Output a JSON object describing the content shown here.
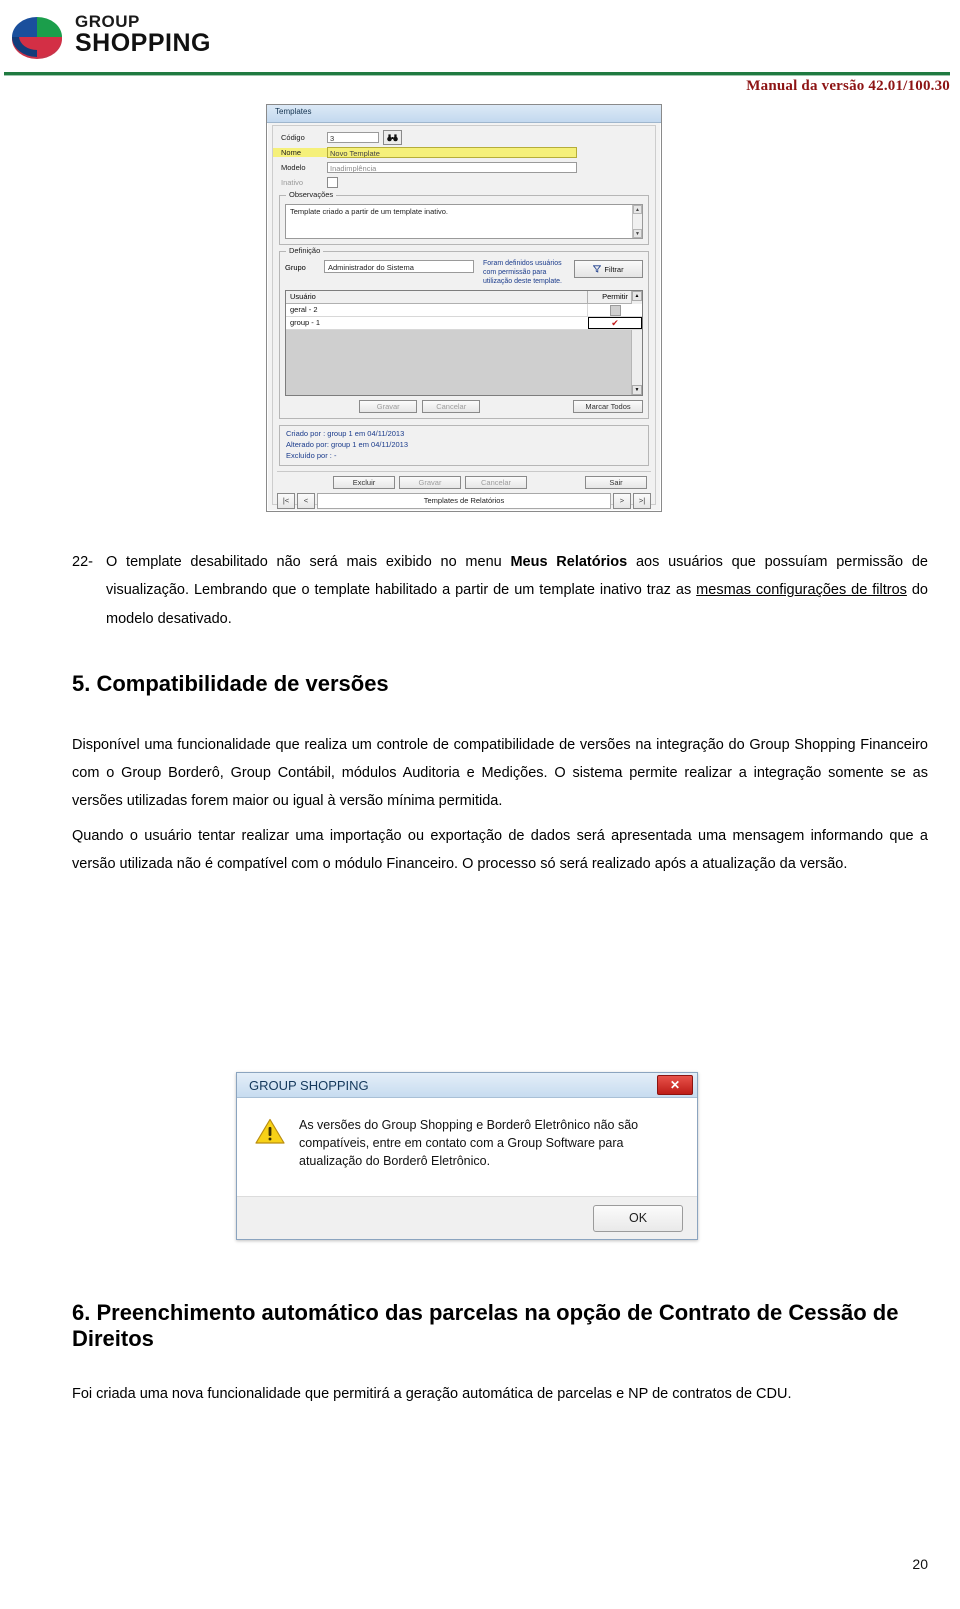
{
  "header": {
    "logo_line1": "GROUP",
    "logo_line2": "SHOPPING",
    "manual_version": "Manual da versão 42.01/100.30"
  },
  "templates_window": {
    "title": "Templates",
    "fields": {
      "codigo_label": "Código",
      "codigo_value": "3",
      "search_icon": "binoculars-icon",
      "nome_label": "Nome",
      "nome_value": "Novo Template",
      "modelo_label": "Modelo",
      "modelo_value": "Inadimplência",
      "inativo_label": "Inativo"
    },
    "observacoes": {
      "legend": "Observações",
      "text": "Template criado a partir de um template inativo."
    },
    "definicao": {
      "legend": "Definição",
      "grupo_label": "Grupo",
      "grupo_value": "Administrador do Sistema",
      "permission_note": "Foram definidos usuários com permissão para utilização deste template.",
      "filtrar_label": "Filtrar"
    },
    "user_table": {
      "columns": [
        "Usuário",
        "Permitir"
      ],
      "rows": [
        {
          "usuario": "geral - 2",
          "permitir": "unchecked"
        },
        {
          "usuario": "group - 1",
          "permitir": "checked"
        }
      ]
    },
    "inner_buttons": {
      "gravar": "Gravar",
      "cancelar": "Cancelar",
      "marcar_todos": "Marcar Todos"
    },
    "audit": {
      "criado": "Criado por  : group 1 em 04/11/2013",
      "alterado": "Alterado por: group 1 em 04/11/2013",
      "excluido": "Excluído por : -"
    },
    "footer_buttons": {
      "excluir": "Excluir",
      "gravar": "Gravar",
      "cancelar": "Cancelar",
      "sair": "Sair"
    },
    "statusbar": {
      "first": "|<",
      "prev": "<",
      "label": "Templates de Relatórios",
      "next": ">",
      "last": ">|"
    }
  },
  "content": {
    "item22_number": "22-",
    "item22_part1": "O template desabilitado não será mais exibido no menu ",
    "item22_bold": "Meus Relatórios",
    "item22_part2": " aos usuários que possuíam permissão de visualização. Lembrando que o template habilitado a partir de um template inativo traz as ",
    "item22_underline": "mesmas configurações de filtros",
    "item22_part3": " do modelo desativado.",
    "section5_title": "5. Compatibilidade de versões",
    "section5_p1": "Disponível uma funcionalidade que realiza um controle de compatibilidade de versões na integração do Group Shopping Financeiro com o Group Borderô, Group Contábil, módulos Auditoria e Medições. O sistema permite realizar a integração somente se as versões utilizadas forem maior ou igual à versão mínima permitida.",
    "section5_p2": "Quando o usuário tentar realizar uma importação ou exportação de dados será apresentada uma mensagem informando que a versão utilizada não é compatível com o módulo Financeiro. O processo só será realizado após a atualização da versão.",
    "section6_title": "6. Preenchimento automático das parcelas na opção de Contrato de Cessão de Direitos",
    "section6_p1": "Foi criada uma nova funcionalidade que permitirá a geração automática de parcelas e NP de contratos de CDU."
  },
  "alert_dialog": {
    "title": "GROUP SHOPPING",
    "close_label": "✕",
    "icon": "warning-icon",
    "message": "As versões do Group Shopping e Borderô Eletrônico não são compatíveis, entre em contato com a Group Software para atualização do Borderô Eletrônico.",
    "ok_label": "OK"
  },
  "page_number": "20",
  "colors": {
    "brand_green": "#1f7a40",
    "manual_red": "#8d1414",
    "highlight_yellow": "#f5f07a",
    "audit_blue": "#1b3c8c"
  }
}
